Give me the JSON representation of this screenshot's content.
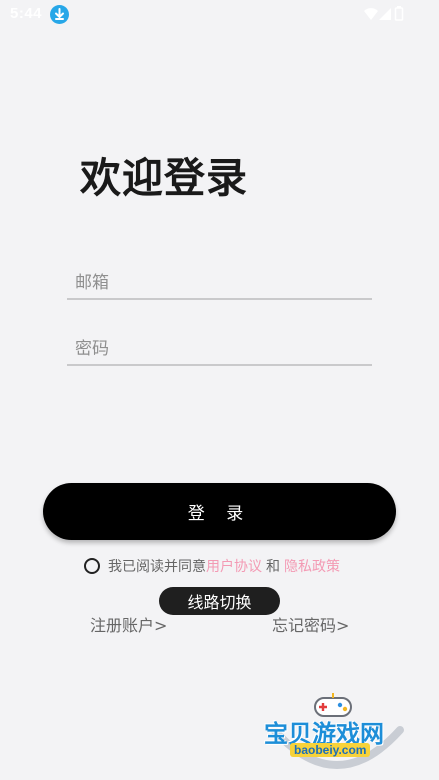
{
  "status_bar": {
    "time": "5:44",
    "icons": [
      "download-icon",
      "wifi-icon",
      "signal-icon",
      "battery-icon"
    ]
  },
  "login": {
    "title": "欢迎登录",
    "email_placeholder": "邮箱",
    "password_placeholder": "密码",
    "login_button": "登 录",
    "agreement": {
      "prefix": "我已阅读并同意",
      "user_agreement": "用户协议",
      "and": "和",
      "privacy_policy": "隐私政策"
    },
    "switch_route": "线路切换",
    "register": "注册账户>",
    "forgot_password": "忘记密码>"
  },
  "watermark": {
    "title": "宝贝游戏网",
    "url": "baobeiy.com"
  },
  "colors": {
    "background": "#f3f3f5",
    "button": "#000000",
    "link_pink": "#f39ab4",
    "status_icon_blue": "#27a7e8"
  }
}
